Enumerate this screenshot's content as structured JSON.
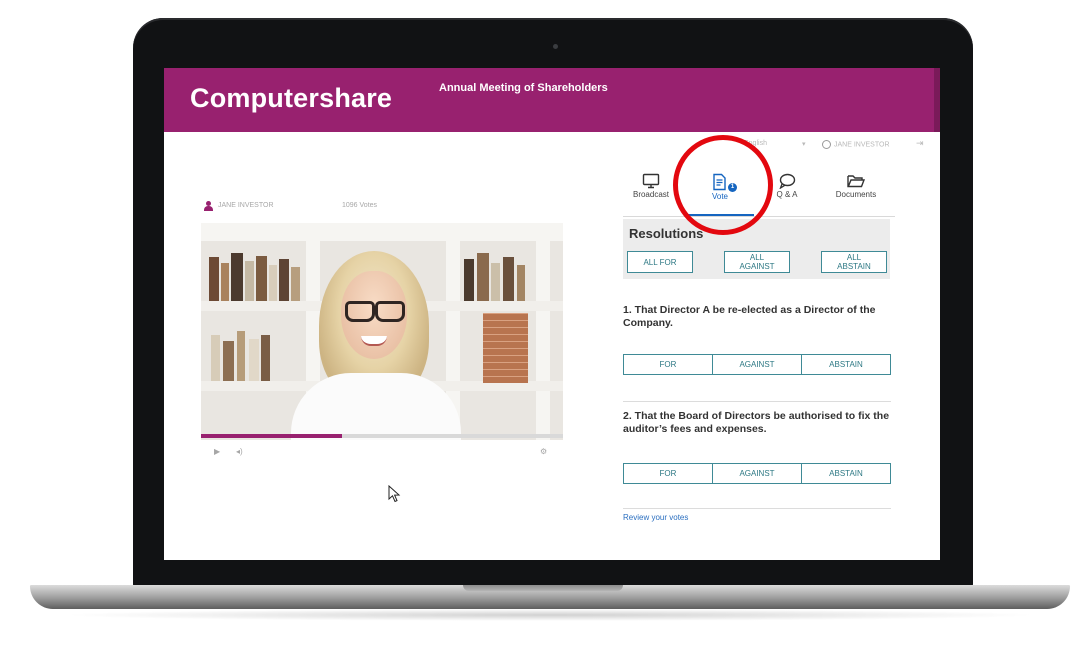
{
  "header": {
    "logo": "Computershare",
    "meeting_title": "Annual Meeting of Shareholders"
  },
  "utility_bar": {
    "language_label": "English",
    "user_name": "JANE INVESTOR"
  },
  "presenter": {
    "name": "JANE INVESTOR",
    "votes": "1096 Votes"
  },
  "video": {
    "progress": 0.39
  },
  "tabs": [
    {
      "label": "Broadcast",
      "icon": "monitor-icon"
    },
    {
      "label": "Vote",
      "icon": "document-icon",
      "badge": "1",
      "active": true
    },
    {
      "label": "Q & A",
      "icon": "speech-bubble-icon"
    },
    {
      "label": "Documents",
      "icon": "folder-icon"
    }
  ],
  "resolutions": {
    "title": "Resolutions",
    "all_for": "ALL FOR",
    "all_against": "ALL AGAINST",
    "all_abstain": "ALL ABSTAIN"
  },
  "questions": [
    {
      "text": "1. That Director A be re-elected as a Director of the Company.",
      "options": [
        "FOR",
        "AGAINST",
        "ABSTAIN"
      ]
    },
    {
      "text": "2. That the Board of Directors be authorised to fix the auditor’s fees and expenses.",
      "options": [
        "FOR",
        "AGAINST",
        "ABSTAIN"
      ]
    }
  ],
  "review_link": "Review your votes",
  "colors": {
    "brand": "#98216f",
    "accent": "#1565c0",
    "button_border": "#3f8a96",
    "highlight": "#e3080f"
  }
}
